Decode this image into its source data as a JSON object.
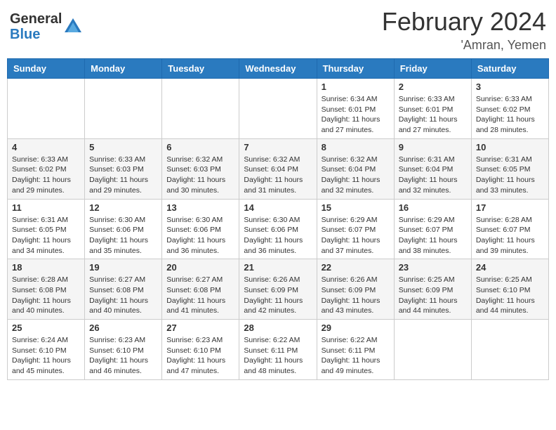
{
  "header": {
    "logo_general": "General",
    "logo_blue": "Blue",
    "month_title": "February 2024",
    "location": "'Amran, Yemen"
  },
  "weekdays": [
    "Sunday",
    "Monday",
    "Tuesday",
    "Wednesday",
    "Thursday",
    "Friday",
    "Saturday"
  ],
  "weeks": [
    [
      {
        "day": "",
        "info": ""
      },
      {
        "day": "",
        "info": ""
      },
      {
        "day": "",
        "info": ""
      },
      {
        "day": "",
        "info": ""
      },
      {
        "day": "1",
        "info": "Sunrise: 6:34 AM\nSunset: 6:01 PM\nDaylight: 11 hours and 27 minutes."
      },
      {
        "day": "2",
        "info": "Sunrise: 6:33 AM\nSunset: 6:01 PM\nDaylight: 11 hours and 27 minutes."
      },
      {
        "day": "3",
        "info": "Sunrise: 6:33 AM\nSunset: 6:02 PM\nDaylight: 11 hours and 28 minutes."
      }
    ],
    [
      {
        "day": "4",
        "info": "Sunrise: 6:33 AM\nSunset: 6:02 PM\nDaylight: 11 hours and 29 minutes."
      },
      {
        "day": "5",
        "info": "Sunrise: 6:33 AM\nSunset: 6:03 PM\nDaylight: 11 hours and 29 minutes."
      },
      {
        "day": "6",
        "info": "Sunrise: 6:32 AM\nSunset: 6:03 PM\nDaylight: 11 hours and 30 minutes."
      },
      {
        "day": "7",
        "info": "Sunrise: 6:32 AM\nSunset: 6:04 PM\nDaylight: 11 hours and 31 minutes."
      },
      {
        "day": "8",
        "info": "Sunrise: 6:32 AM\nSunset: 6:04 PM\nDaylight: 11 hours and 32 minutes."
      },
      {
        "day": "9",
        "info": "Sunrise: 6:31 AM\nSunset: 6:04 PM\nDaylight: 11 hours and 32 minutes."
      },
      {
        "day": "10",
        "info": "Sunrise: 6:31 AM\nSunset: 6:05 PM\nDaylight: 11 hours and 33 minutes."
      }
    ],
    [
      {
        "day": "11",
        "info": "Sunrise: 6:31 AM\nSunset: 6:05 PM\nDaylight: 11 hours and 34 minutes."
      },
      {
        "day": "12",
        "info": "Sunrise: 6:30 AM\nSunset: 6:06 PM\nDaylight: 11 hours and 35 minutes."
      },
      {
        "day": "13",
        "info": "Sunrise: 6:30 AM\nSunset: 6:06 PM\nDaylight: 11 hours and 36 minutes."
      },
      {
        "day": "14",
        "info": "Sunrise: 6:30 AM\nSunset: 6:06 PM\nDaylight: 11 hours and 36 minutes."
      },
      {
        "day": "15",
        "info": "Sunrise: 6:29 AM\nSunset: 6:07 PM\nDaylight: 11 hours and 37 minutes."
      },
      {
        "day": "16",
        "info": "Sunrise: 6:29 AM\nSunset: 6:07 PM\nDaylight: 11 hours and 38 minutes."
      },
      {
        "day": "17",
        "info": "Sunrise: 6:28 AM\nSunset: 6:07 PM\nDaylight: 11 hours and 39 minutes."
      }
    ],
    [
      {
        "day": "18",
        "info": "Sunrise: 6:28 AM\nSunset: 6:08 PM\nDaylight: 11 hours and 40 minutes."
      },
      {
        "day": "19",
        "info": "Sunrise: 6:27 AM\nSunset: 6:08 PM\nDaylight: 11 hours and 40 minutes."
      },
      {
        "day": "20",
        "info": "Sunrise: 6:27 AM\nSunset: 6:08 PM\nDaylight: 11 hours and 41 minutes."
      },
      {
        "day": "21",
        "info": "Sunrise: 6:26 AM\nSunset: 6:09 PM\nDaylight: 11 hours and 42 minutes."
      },
      {
        "day": "22",
        "info": "Sunrise: 6:26 AM\nSunset: 6:09 PM\nDaylight: 11 hours and 43 minutes."
      },
      {
        "day": "23",
        "info": "Sunrise: 6:25 AM\nSunset: 6:09 PM\nDaylight: 11 hours and 44 minutes."
      },
      {
        "day": "24",
        "info": "Sunrise: 6:25 AM\nSunset: 6:10 PM\nDaylight: 11 hours and 44 minutes."
      }
    ],
    [
      {
        "day": "25",
        "info": "Sunrise: 6:24 AM\nSunset: 6:10 PM\nDaylight: 11 hours and 45 minutes."
      },
      {
        "day": "26",
        "info": "Sunrise: 6:23 AM\nSunset: 6:10 PM\nDaylight: 11 hours and 46 minutes."
      },
      {
        "day": "27",
        "info": "Sunrise: 6:23 AM\nSunset: 6:10 PM\nDaylight: 11 hours and 47 minutes."
      },
      {
        "day": "28",
        "info": "Sunrise: 6:22 AM\nSunset: 6:11 PM\nDaylight: 11 hours and 48 minutes."
      },
      {
        "day": "29",
        "info": "Sunrise: 6:22 AM\nSunset: 6:11 PM\nDaylight: 11 hours and 49 minutes."
      },
      {
        "day": "",
        "info": ""
      },
      {
        "day": "",
        "info": ""
      }
    ]
  ]
}
